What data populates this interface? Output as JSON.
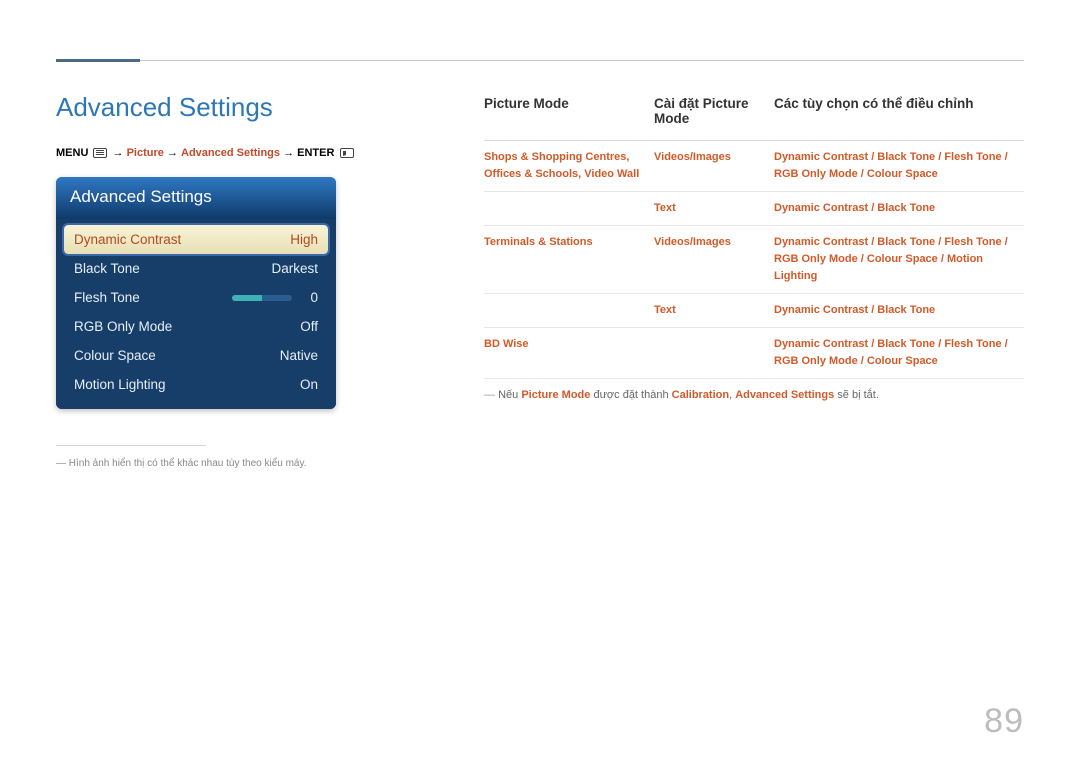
{
  "page_number": "89",
  "title": "Advanced Settings",
  "breadcrumb": {
    "menu": "MENU",
    "seg1": "Picture",
    "seg2": "Advanced Settings",
    "enter": "ENTER"
  },
  "panel": {
    "header": "Advanced Settings",
    "rows": [
      {
        "label": "Dynamic Contrast",
        "value": "High",
        "selected": true
      },
      {
        "label": "Black Tone",
        "value": "Darkest"
      },
      {
        "label": "Flesh Tone",
        "value": "0",
        "slider": true
      },
      {
        "label": "RGB Only Mode",
        "value": "Off"
      },
      {
        "label": "Colour Space",
        "value": "Native"
      },
      {
        "label": "Motion Lighting",
        "value": "On"
      }
    ]
  },
  "footnote": "Hình ảnh hiển thị có thể khác nhau tùy theo kiểu máy.",
  "table": {
    "headers": [
      "Picture Mode",
      "Cài đặt Picture Mode",
      "Các tùy chọn có thể điều chỉnh"
    ],
    "rows": [
      {
        "col1": "Shops & Shopping Centres, Offices & Schools, Video Wall",
        "col2": "Videos/Images",
        "col3": "Dynamic Contrast / Black Tone / Flesh Tone / RGB Only Mode / Colour Space"
      },
      {
        "col1": "",
        "col2": "Text",
        "col3": "Dynamic Contrast / Black Tone"
      },
      {
        "col1": "Terminals & Stations",
        "col2": "Videos/Images",
        "col3": "Dynamic Contrast / Black Tone / Flesh Tone / RGB Only Mode / Colour Space / Motion Lighting"
      },
      {
        "col1": "",
        "col2": "Text",
        "col3": "Dynamic Contrast / Black Tone"
      },
      {
        "col1": "BD Wise",
        "col2": "",
        "col3": "Dynamic Contrast / Black Tone / Flesh Tone / RGB Only Mode / Colour Space"
      }
    ]
  },
  "table_note": {
    "pre": "Nếu ",
    "b1": "Picture Mode",
    "mid": " được đặt thành ",
    "b2": "Calibration",
    "sep": ", ",
    "b3": "Advanced Settings",
    "post": " sẽ bị tắt."
  }
}
